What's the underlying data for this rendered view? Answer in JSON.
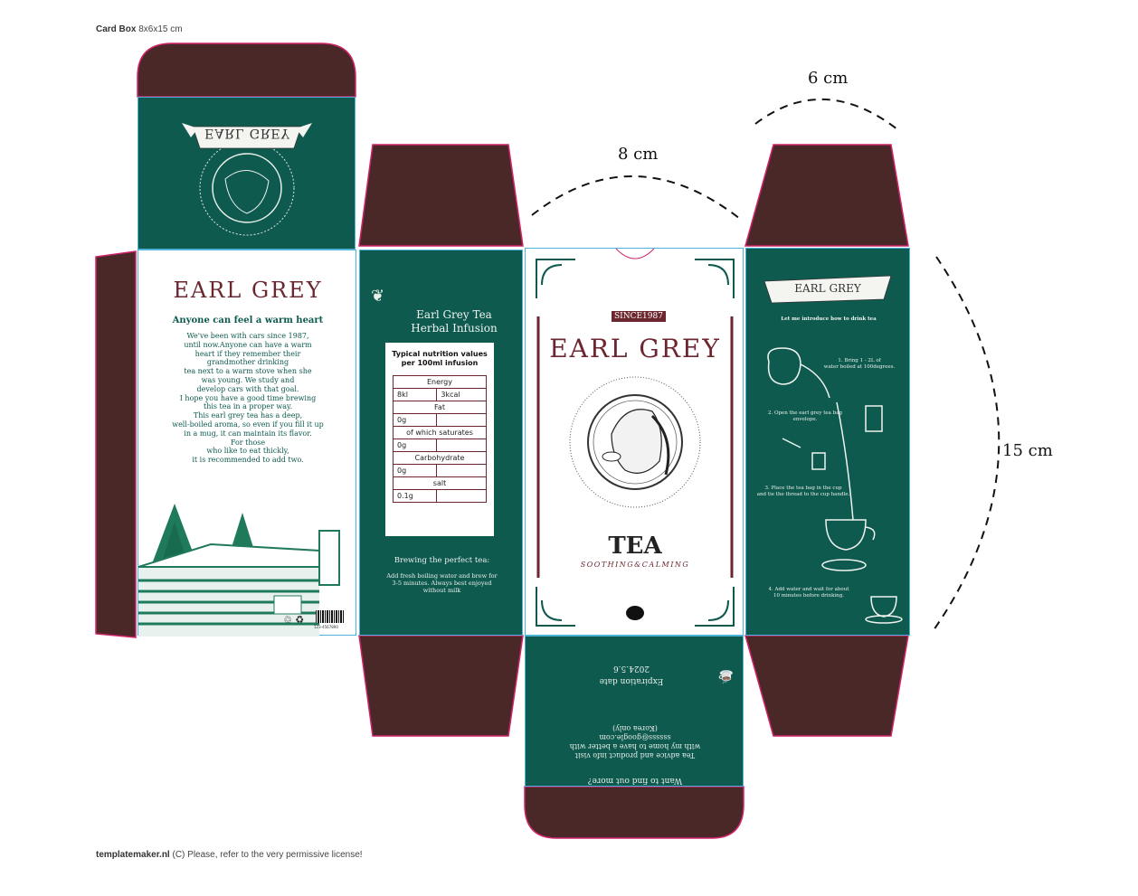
{
  "header": {
    "brand": "Card Box",
    "size": "8x6x15 cm"
  },
  "footer": {
    "brand": "templatemaker.nl",
    "license": "(C) Please, refer to the very permissive license!"
  },
  "dimensions": {
    "width": "8 cm",
    "depth": "6 cm",
    "height": "15 cm"
  },
  "colors": {
    "green": "#0e5a4f",
    "maroon": "#4a2828",
    "outline": "#d0246a",
    "fold": "#4fb3d9",
    "wine": "#6b2630"
  },
  "top_flap": {
    "ribbon": "EARL GREY"
  },
  "back_panel": {
    "title": "EARL GREY",
    "subtitle": "Anyone can feel a warm heart",
    "body": [
      "We've been with cars since 1987,",
      "until now.Anyone can have a warm",
      "heart if they remember their",
      "grandmother drinking",
      "tea next to a warm stove when she",
      "was young. We study and",
      "develop cars with that goal.",
      "I hope you have a good time brewing",
      "this tea in a proper way.",
      "This earl grey tea has a deep,",
      "well-boiled aroma,  so even if you fill it up",
      "in a mug, it can maintain its flavor.",
      "For those",
      "who like to eat thickly,",
      "it is recommended to add two."
    ]
  },
  "left_panel": {
    "title": [
      "Earl Grey Tea",
      "Herbal Infusion"
    ],
    "nutrition": {
      "heading": [
        "Typical nutrition values",
        "per 100ml infusion"
      ],
      "energy": "Energy",
      "energy_kj": "8kl",
      "energy_kcal": "3kcal",
      "fat": "Fat",
      "fat_val": "0g",
      "saturates": "of which saturates",
      "saturates_val": "0g",
      "carb": "Carbohydrate",
      "carb_val": "0g",
      "salt": "salt",
      "salt_val": "0.1g"
    },
    "brewing_title": "Brewing the perfect tea:",
    "brewing_text": [
      "Add fresh boiling water and brew for",
      "3-5 minutes. Always best enjoyed",
      "without milk"
    ]
  },
  "front_panel": {
    "since": "SINCE1987",
    "title": "EARL GREY",
    "tea": "TEA",
    "tagline": "SOOTHING&CALMING"
  },
  "right_panel": {
    "ribbon": "EARL GREY",
    "intro": "Let me introduce how to drink tea",
    "steps": [
      [
        "1. Bring 1 - 2L of",
        "water boiled at 100degrees."
      ],
      [
        "2. Open the earl grey tea bag",
        "envelope."
      ],
      [
        "3. Place the tea bag in the cup",
        "and tie the thread to the cup handle."
      ],
      [
        "4. Add water and wait for about",
        "10 minutes before drinking."
      ]
    ]
  },
  "bottom_flap": {
    "expiration": "Expiration date",
    "date": "2024.5.6",
    "lines": [
      "Want to find out more?",
      "Tea advice and product info visit",
      "with my home to have a better with",
      "ssssss@google.com",
      "(Korea only)"
    ]
  },
  "barcode": {
    "number": "123-4567890"
  }
}
